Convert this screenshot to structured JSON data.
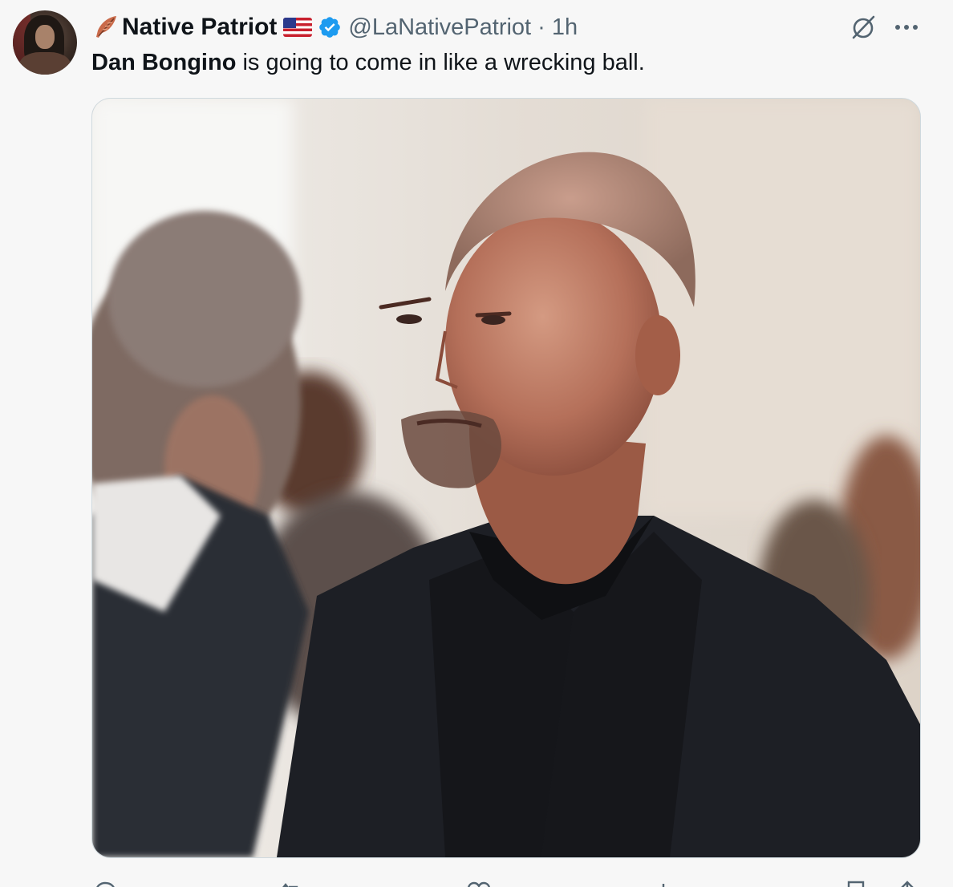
{
  "post": {
    "display_name": "Native Patriot",
    "name_prefix_icon": "feather-icon",
    "name_suffix_icon": "us-flag-icon",
    "verified_icon": "verified-badge-icon",
    "handle": "@LaNativePatriot",
    "separator": "·",
    "time": "1h",
    "text_mention": "Dan Bongino",
    "text_rest": " is going to come in like a wrecking ball.",
    "media_icon": "photo-image",
    "colors": {
      "text": "#0f1419",
      "secondary": "#536471",
      "verified": "#1d9bf0",
      "background": "#f7f7f7",
      "border": "#cfd9de"
    }
  },
  "toolbar": {
    "icons": [
      "grok-icon",
      "more-icon"
    ]
  },
  "actions": {
    "icons": [
      "reply-icon",
      "repost-icon",
      "like-icon",
      "views-icon",
      "bookmark-icon",
      "share-icon"
    ]
  }
}
